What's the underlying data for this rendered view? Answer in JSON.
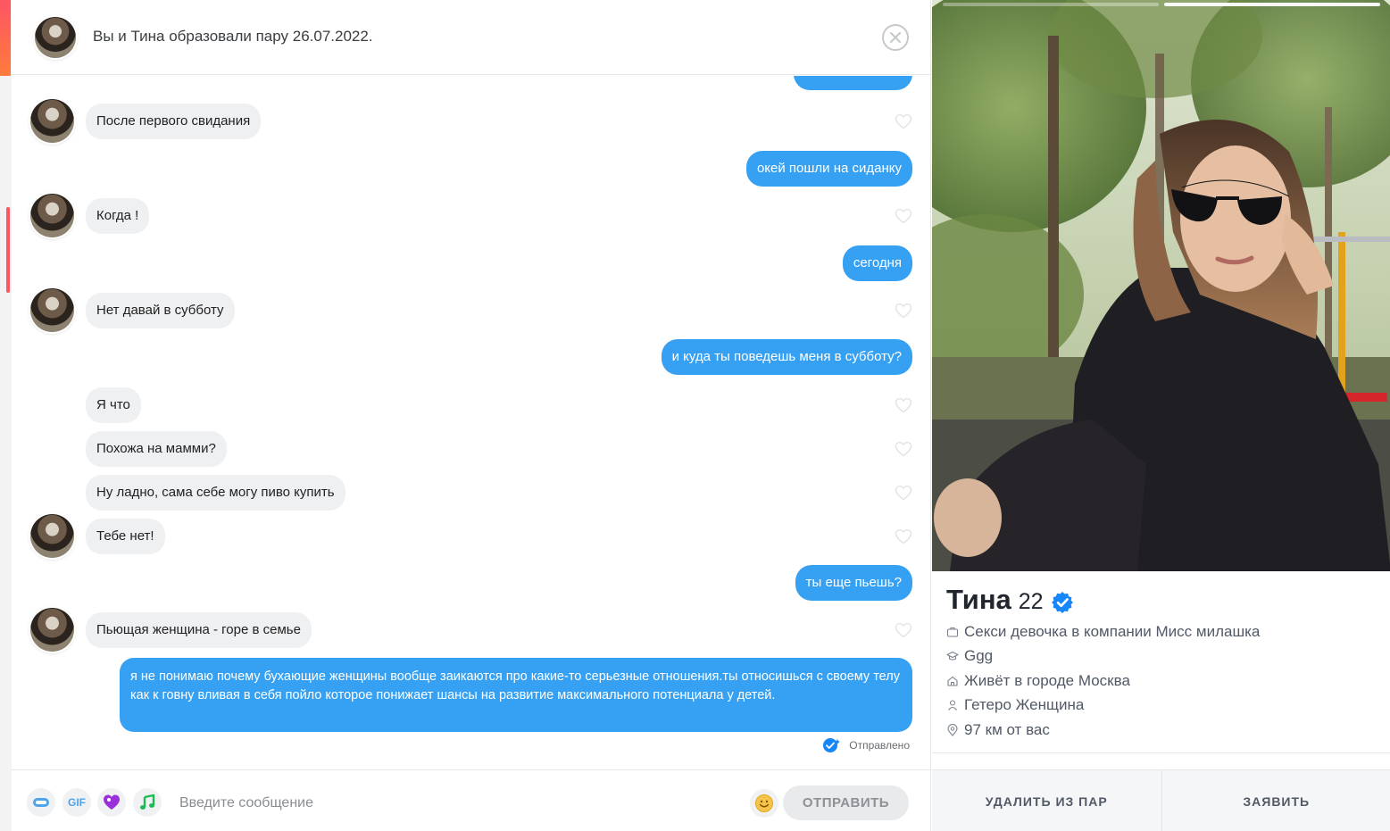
{
  "header": {
    "match_text": "Вы и Тина образовали пару 26.07.2022."
  },
  "messages": [
    {
      "dir": "in",
      "text": "После первого свидания"
    },
    {
      "dir": "out",
      "text": "окей пошли на сиданку"
    },
    {
      "dir": "in",
      "text": "Когда !"
    },
    {
      "dir": "out",
      "text": "сегодня"
    },
    {
      "dir": "in",
      "text": "Нет давай в субботу"
    },
    {
      "dir": "out",
      "text": "и куда ты поведешь меня в субботу?"
    },
    {
      "dir": "in",
      "text": "Я что"
    },
    {
      "dir": "in",
      "text": "Похожа на мамми?"
    },
    {
      "dir": "in",
      "text": "Ну ладно, сама себе могу пиво купить"
    },
    {
      "dir": "in",
      "text": "Тебе нет!"
    },
    {
      "dir": "out",
      "text": "ты еще пьешь?"
    },
    {
      "dir": "in",
      "text": "Пьющая женщина - горе в семье"
    },
    {
      "dir": "out",
      "text": "я не понимаю почему бухающие женщины вообще заикаются про какие-то серьезные отношения.ты относишься с своему телу как к говну вливая в себя пойло которое понижает шансы на развитие максимального потенциала у детей."
    }
  ],
  "status": {
    "sent": "Отправлено"
  },
  "composer": {
    "gif_label": "GIF",
    "placeholder": "Введите сообщение",
    "send_label": "ОТПРАВИТЬ"
  },
  "profile": {
    "name": "Тина",
    "age": "22",
    "job": "Секси девочка в компании Мисс милашка",
    "school": "Ggg",
    "city": "Живёт в городе Москва",
    "orientation": "Гетеро Женщина",
    "distance": "97 км от вас",
    "photo_count": 2,
    "active_photo": 2
  },
  "actions": {
    "unmatch": "УДАЛИТЬ ИЗ ПАР",
    "report": "ЗАЯВИТЬ"
  },
  "colors": {
    "accent": "#fd5564",
    "outgoing_bubble": "#36a0f3",
    "incoming_bubble": "#eff0f2",
    "verified": "#1786f8"
  }
}
